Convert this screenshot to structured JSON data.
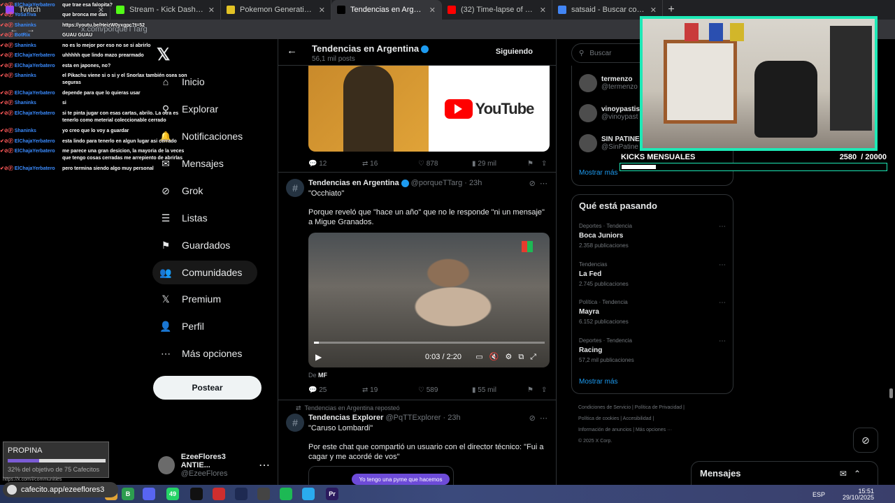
{
  "browser": {
    "tabs": [
      {
        "title": "Twitch",
        "color": "#9146ff",
        "active": false
      },
      {
        "title": "Stream - Kick Dashboard",
        "color": "#53fc18",
        "active": false
      },
      {
        "title": "Pokemon Generations Starter D",
        "color": "#e3c325",
        "active": false
      },
      {
        "title": "Tendencias en Argentina (@po",
        "color": "#000000",
        "active": true
      },
      {
        "title": "(32) Time-lapse of Madison Sq",
        "color": "#ff0000",
        "active": false
      },
      {
        "title": "satsaid - Buscar con Google",
        "color": "#4285f4",
        "active": false
      }
    ],
    "new_tab": "+",
    "url": "x.com/porqueTTarg"
  },
  "sidebar": {
    "logo": "𝕏",
    "items": [
      {
        "label": "Inicio",
        "icon": "home-icon",
        "glyph": "⌂"
      },
      {
        "label": "Explorar",
        "icon": "search-icon",
        "glyph": "⚲"
      },
      {
        "label": "Notificaciones",
        "icon": "bell-icon",
        "glyph": "🔔"
      },
      {
        "label": "Mensajes",
        "icon": "mail-icon",
        "glyph": "✉"
      },
      {
        "label": "Grok",
        "icon": "grok-icon",
        "glyph": "⊘"
      },
      {
        "label": "Listas",
        "icon": "list-icon",
        "glyph": "☰"
      },
      {
        "label": "Guardados",
        "icon": "bookmark-icon",
        "glyph": "⚑"
      },
      {
        "label": "Comunidades",
        "icon": "people-icon",
        "glyph": "👥"
      },
      {
        "label": "Premium",
        "icon": "x-premium-icon",
        "glyph": "𝕏"
      },
      {
        "label": "Perfil",
        "icon": "person-icon",
        "glyph": "👤"
      },
      {
        "label": "Más opciones",
        "icon": "more-circle-icon",
        "glyph": "⋯"
      }
    ],
    "post_button": "Postear",
    "profile": {
      "name": "EzeeFlores3 ANTIE...",
      "handle": "@EzeeFlores",
      "more": "⋯"
    }
  },
  "timeline": {
    "header": {
      "title": "Tendencias en Argentina",
      "subtitle": "56,1 mil posts",
      "follow": "Siguiendo",
      "back": "←"
    },
    "media1": {
      "brand": "YouTube"
    },
    "post1_actions": {
      "replies": "12",
      "reposts": "16",
      "likes": "878",
      "views": "29 mil"
    },
    "post2": {
      "name": "Tendencias en Argentina",
      "meta": "@porqueTTarg · 23h",
      "text1": "\"Occhiato\"",
      "text2": "Porque reveló que \"hace un año\" que no le responde \"ni un mensaje\" a Migue Granados.",
      "video_time": "0:03 / 2:20",
      "video_progress": 0.02,
      "credit_prefix": "De",
      "credit": "MF",
      "actions": {
        "replies": "25",
        "reposts": "19",
        "likes": "589",
        "views": "55 mil"
      }
    },
    "post3": {
      "repost_label": "Tendencias en Argentina reposteó",
      "name": "Tendencias Explorer",
      "meta": "@PqTTExplorer · 23h",
      "text1": "\"Caruso Lombardi\"",
      "text2": "Por este chat que compartió un usuario con el director técnico: \"Fui a cagar y me acordé de vos\"",
      "chat_preview": "Yo tengo una pyme que hacemos"
    }
  },
  "rightcol": {
    "search_placeholder": "Buscar",
    "who_to_follow": [
      {
        "name": "termenzo",
        "handle": "@termenzo"
      },
      {
        "name": "vinoypastis",
        "handle": "@vinoypast"
      },
      {
        "name": "SIN PATINES",
        "handle": "@SinPatine"
      }
    ],
    "show_more": "Mostrar más",
    "trends_title": "Qué está pasando",
    "trends": [
      {
        "category": "Deportes · Tendencia",
        "name": "Boca Juniors",
        "count": "2.358 publicaciones"
      },
      {
        "category": "Tendencias",
        "name": "La Fed",
        "count": "2.745 publicaciones"
      },
      {
        "category": "Política · Tendencia",
        "name": "Mayra",
        "count": "6.152 publicaciones"
      },
      {
        "category": "Deportes · Tendencia",
        "name": "Racing",
        "count": "57,2 mil publicaciones"
      }
    ],
    "trends_more": "Mostrar más",
    "footer": [
      "Condiciones de Servicio  |  Política de Privacidad  |",
      "Política de cookies  |  Accesibilidad  |",
      "Información de anuncios  |  Más opciones ···",
      "© 2025 X Corp."
    ],
    "messages_dock": "Mensajes"
  },
  "stream_chat": [
    {
      "user": "ElChajaYerbatero",
      "msg": "que trae esa falopita?"
    },
    {
      "user": "YoSaTiva",
      "msg": "que bronca me dan"
    },
    {
      "user": "Shaninks",
      "msg": "https://youtu.be/HeizW0yxgpc?t=52"
    },
    {
      "user": "BotRix",
      "msg": "GUAU GUAU"
    },
    {
      "user": "Shaninks",
      "msg": "no es lo mejor por eso no se si abrirlo"
    },
    {
      "user": "ElChajaYerbatero",
      "msg": "uhhhhh que lindo mazo prearmado"
    },
    {
      "user": "ElChajaYerbatero",
      "msg": "esta en japones, no?"
    },
    {
      "user": "Shaninks",
      "msg": "el Pikachu viene si o si y el Snorlax también osea son seguras"
    },
    {
      "user": "ElChajaYerbatero",
      "msg": "depende para que lo quieras usar"
    },
    {
      "user": "Shaninks",
      "msg": "si"
    },
    {
      "user": "ElChajaYerbatero",
      "msg": "si te pinta jugar con esas cartas, abrilo. La otra es tenerlo como meterial coleccionable cerrado"
    },
    {
      "user": "Shaninks",
      "msg": "yo creo que lo voy a guardar"
    },
    {
      "user": "ElChajaYerbatero",
      "msg": "esta lindo para tenerlo en algun lugar asi cerrado"
    },
    {
      "user": "ElChajaYerbatero",
      "msg": "me parece una gran desicion, la mayoria de la veces que tengo cosas cerradas me arrepiento de abrirlas"
    },
    {
      "user": "ElChajaYerbatero",
      "msg": "pero termina siendo algo muy personal"
    }
  ],
  "subgoal": {
    "label": "KICKS MENSUALES",
    "current": "2580",
    "target": "/ 20000",
    "fraction": 0.129
  },
  "tip": {
    "title": "PROPINA",
    "fraction": 0.32,
    "progress_text": "32% del objetivo de 75 Cafecitos",
    "link": "cafecito.app/ezeeflores3",
    "status_url": "https://x.com/i/communities"
  },
  "taskbar": {
    "lang": "ESP",
    "time": "15:51",
    "date": "29/10/2025",
    "badge": "49"
  },
  "colors": {
    "accent": "#1d9bf0",
    "cam_border": "#1de9b6",
    "chat_user": "#3b8cff"
  }
}
